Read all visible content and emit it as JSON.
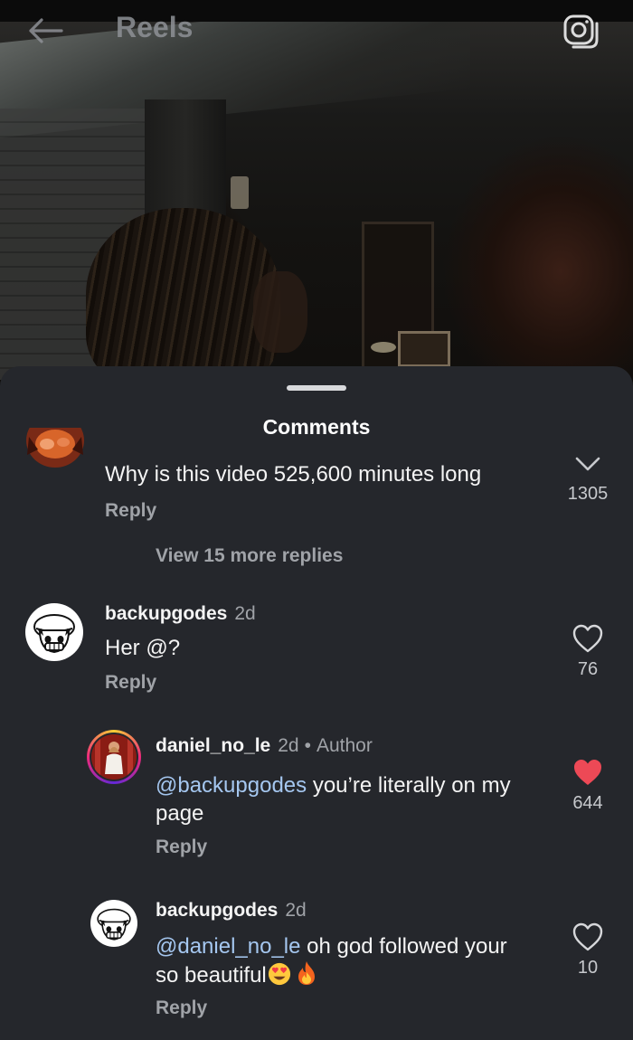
{
  "header": {
    "title": "Reels",
    "back_icon": "arrow-left-icon",
    "camera_icon": "camera-icon"
  },
  "sheet": {
    "title": "Comments"
  },
  "comments": [
    {
      "username": "",
      "text": "Why is this video 525,600 minutes long",
      "reply_label": "Reply",
      "like_count": "1305",
      "view_more": "View 15 more replies"
    },
    {
      "username": "backupgodes",
      "time": "2d",
      "text": "Her @?",
      "reply_label": "Reply",
      "like_count": "76",
      "liked": false
    },
    {
      "username": "daniel_no_le",
      "time": "2d",
      "author_label": "Author",
      "mention": "@backupgodes",
      "text_line1": " you’re literally on my",
      "text_line2": "page",
      "reply_label": "Reply",
      "like_count": "644",
      "liked": true
    },
    {
      "username": "backupgodes",
      "time": "2d",
      "mention": "@daniel_no_le",
      "text_line1": " oh god followed your",
      "text_line2": "so beautiful",
      "reply_label": "Reply",
      "like_count": "10",
      "liked": false
    }
  ],
  "colors": {
    "sheet_bg": "#25272c",
    "mention": "#a5c7f0",
    "liked_heart": "#ed4956",
    "muted_text": "#a0a3a8"
  }
}
